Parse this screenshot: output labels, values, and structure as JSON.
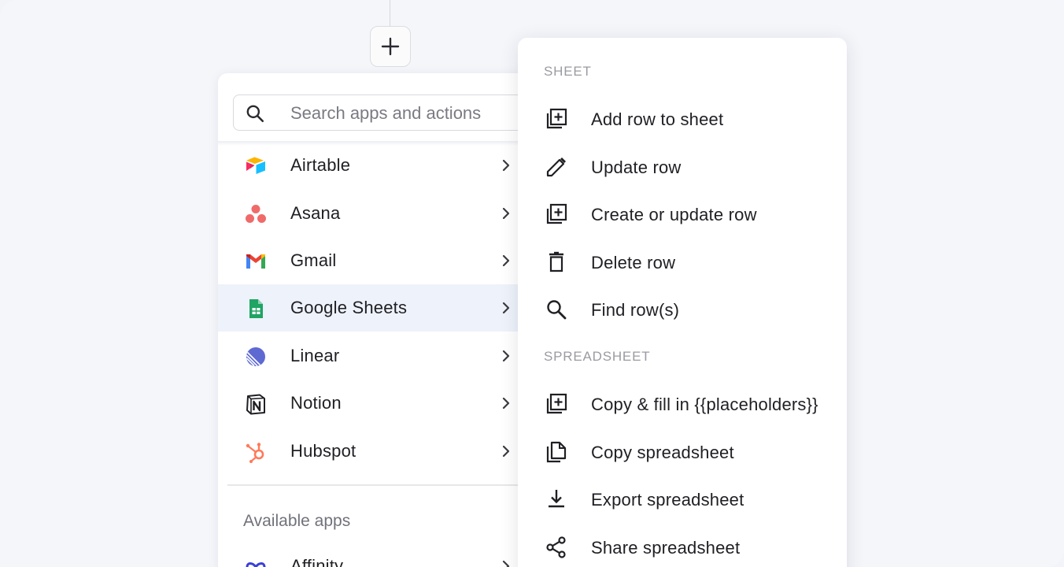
{
  "search": {
    "placeholder": "Search apps and actions"
  },
  "apps": [
    {
      "label": "Airtable",
      "icon": "airtable-icon"
    },
    {
      "label": "Asana",
      "icon": "asana-icon"
    },
    {
      "label": "Gmail",
      "icon": "gmail-icon"
    },
    {
      "label": "Google Sheets",
      "icon": "google-sheets-icon",
      "selected": true
    },
    {
      "label": "Linear",
      "icon": "linear-icon"
    },
    {
      "label": "Notion",
      "icon": "notion-icon"
    },
    {
      "label": "Hubspot",
      "icon": "hubspot-icon"
    }
  ],
  "available": {
    "label": "Available apps",
    "items": [
      {
        "label": "Affinity",
        "icon": "affinity-icon"
      }
    ]
  },
  "actions": {
    "sheet_label": "SHEET",
    "sheet": [
      {
        "label": "Add row to sheet",
        "icon": "add-row-icon"
      },
      {
        "label": "Update row",
        "icon": "pencil-icon"
      },
      {
        "label": "Create or update row",
        "icon": "add-row-icon"
      },
      {
        "label": "Delete row",
        "icon": "trash-icon"
      },
      {
        "label": "Find row(s)",
        "icon": "search-icon"
      }
    ],
    "spreadsheet_label": "SPREADSHEET",
    "spreadsheet": [
      {
        "label": "Copy & fill in {{placeholders}}",
        "icon": "add-row-icon"
      },
      {
        "label": "Copy spreadsheet",
        "icon": "copy-icon"
      },
      {
        "label": "Export spreadsheet",
        "icon": "download-icon"
      },
      {
        "label": "Share spreadsheet",
        "icon": "share-icon"
      }
    ]
  },
  "colors": {
    "selected_row": "#eef2fa",
    "asana": "#f06a6a",
    "sheets_green": "#1fa463",
    "linear": "#5e6ad2",
    "hubspot": "#ff7a59"
  }
}
